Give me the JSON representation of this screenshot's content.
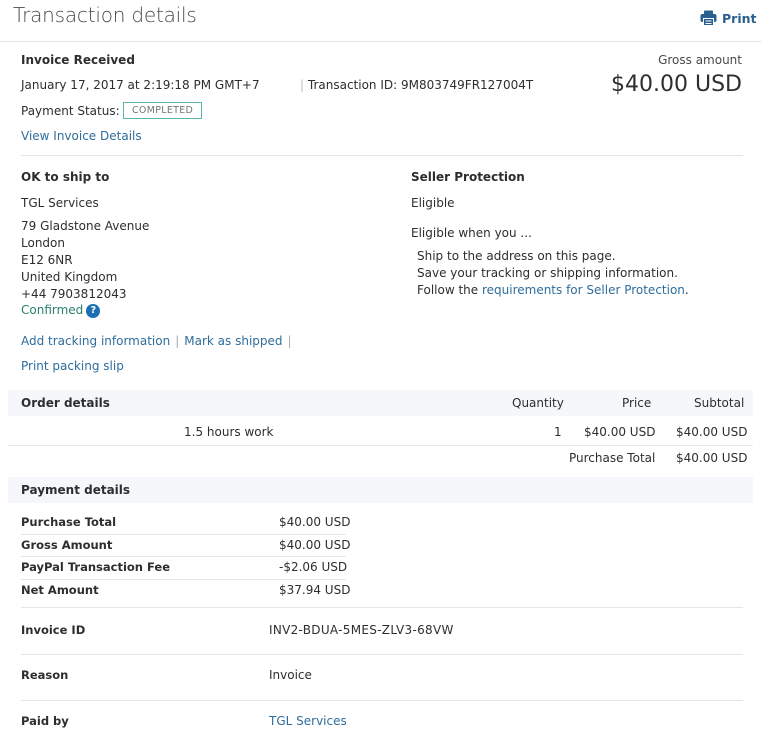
{
  "header": {
    "title": "Transaction details",
    "print_label": "Print"
  },
  "summary": {
    "heading": "Invoice Received",
    "datetime": "January 17, 2017 at 2:19:18 PM GMT+7",
    "transaction_id_label": "Transaction ID:",
    "transaction_id": "9M803749FR127004T",
    "payment_status_label": "Payment Status:",
    "payment_status": "COMPLETED",
    "view_invoice_link": "View Invoice Details",
    "gross_label": "Gross amount",
    "gross_amount": "$40.00 USD"
  },
  "shipping": {
    "heading": "OK to ship to",
    "name": "TGL Services",
    "address": [
      "79 Gladstone Avenue",
      "London",
      "E12 6NR",
      "United Kingdom",
      "+44 7903812043"
    ],
    "confirmed": "Confirmed",
    "help_glyph": "?",
    "actions": [
      "Add tracking information",
      "Mark as shipped"
    ],
    "print_slip": "Print packing slip"
  },
  "seller_protection": {
    "heading": "Seller Protection",
    "status": "Eligible",
    "eligible_when": "Eligible when you ...",
    "conditions": [
      "Ship to the address on this page.",
      "Save your tracking or shipping information."
    ],
    "follow_prefix": "Follow the ",
    "follow_link": "requirements for Seller Protection",
    "follow_suffix": "."
  },
  "order": {
    "heading": "Order details",
    "columns": [
      "Quantity",
      "Price",
      "Subtotal"
    ],
    "items": [
      {
        "description": "1.5 hours work",
        "quantity": "1",
        "price": "$40.00 USD",
        "subtotal": "$40.00 USD"
      }
    ],
    "total_label": "Purchase Total",
    "total_value": "$40.00 USD"
  },
  "payment": {
    "heading": "Payment details",
    "rows": [
      {
        "label": "Purchase Total",
        "value": "$40.00 USD"
      },
      {
        "label": "Gross Amount",
        "value": "$40.00 USD"
      },
      {
        "label": "PayPal Transaction Fee",
        "value": "-$2.06 USD"
      },
      {
        "label": "Net Amount",
        "value": "$37.94 USD"
      }
    ],
    "invoice_id_label": "Invoice ID",
    "invoice_id": "INV2-BDUA-5MES-ZLV3-68VW",
    "reason_label": "Reason",
    "reason": "Invoice",
    "paid_by_label": "Paid by",
    "paid_by": "TGL Services"
  },
  "colors": {
    "link": "#2f6d9c",
    "badge_border": "#5bb5a8",
    "help_icon": "#1d6fb4",
    "band_bg": "#f5f7fa"
  }
}
